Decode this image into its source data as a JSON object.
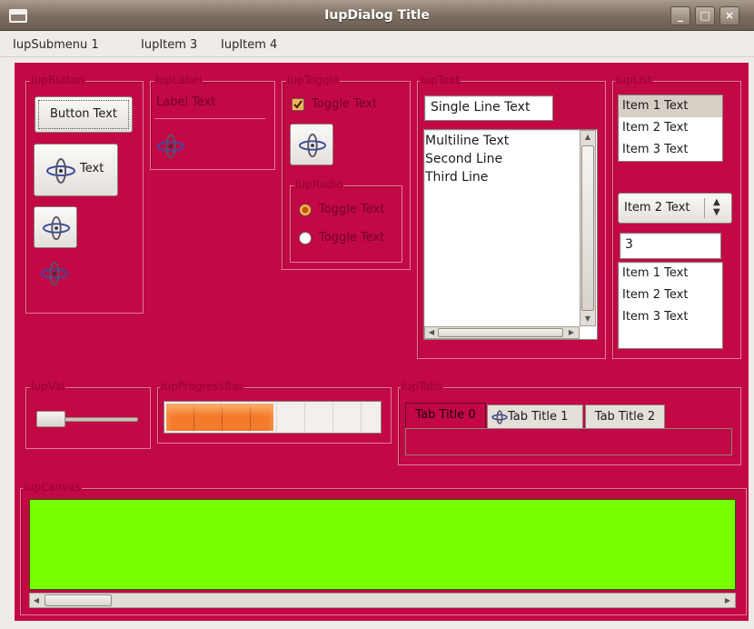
{
  "window": {
    "title": "IupDialog Title",
    "minimize": "_",
    "maximize": "□",
    "close": "×"
  },
  "menu": [
    "IupSubmenu 1",
    "IupItem 3",
    "IupItem 4"
  ],
  "frames": {
    "button": "IupButton",
    "label": "IupLabel",
    "toggle": "IupToggle",
    "radio": "IupRadio",
    "text": "IupText",
    "list": "IupList",
    "val": "IupVal",
    "progress": "IupProgressBar",
    "tabs": "IupTabs",
    "canvas": "IupCanvas"
  },
  "buttons": {
    "text_button": "Button Text",
    "icon_text_button": "Text"
  },
  "label": {
    "text": "Label Text"
  },
  "toggle": {
    "text": "Toggle Text",
    "checked": true
  },
  "radio": [
    {
      "label": "Toggle Text",
      "selected": true
    },
    {
      "label": "Toggle Text",
      "selected": false
    }
  ],
  "text": {
    "single_line": "Single Line Text",
    "multiline": [
      "Multiline Text",
      "Second Line",
      "Third Line"
    ]
  },
  "list": {
    "list1": [
      "Item 1 Text",
      "Item 2 Text",
      "Item 3 Text"
    ],
    "list1_selected": "Item 1 Text",
    "dropdown_value": "Item 2 Text",
    "edit_value": "3",
    "list3": [
      "Item 1 Text",
      "Item 2 Text",
      "Item 3 Text"
    ]
  },
  "progress": {
    "fraction": 0.5
  },
  "val": {
    "fraction": 0.0
  },
  "tabs": [
    "Tab Title 0",
    "Tab Title 1",
    "Tab Title 2"
  ],
  "active_tab": "Tab Title 0",
  "colors": {
    "client_bg": "#c20845",
    "canvas_bg": "#77ff00",
    "progress_fill": "#f07020",
    "title_text": "#ffffff"
  },
  "icons": [
    "window-menu-icon",
    "iup-logo-icon",
    "checkbox-checked-icon",
    "radio-selected-icon",
    "radio-unselected-icon",
    "spin-arrows-icon"
  ]
}
